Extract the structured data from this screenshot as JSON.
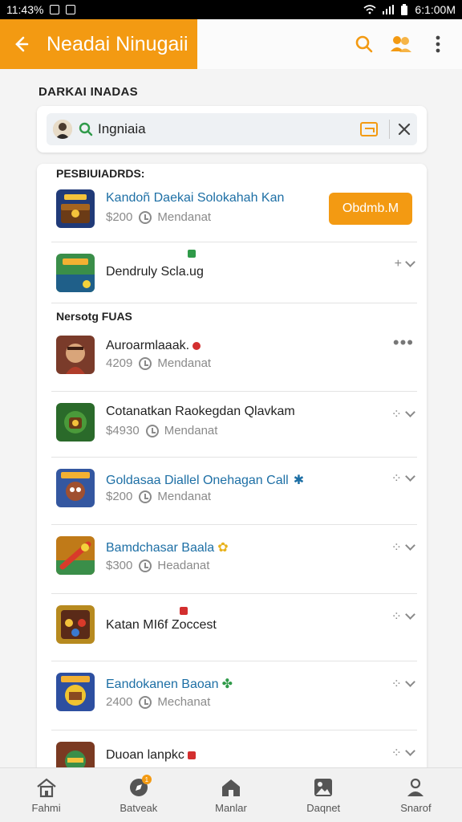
{
  "status_bar": {
    "time": "11:43%",
    "right_time": "6:1:00M"
  },
  "app_bar": {
    "title": "Neadai Ninugaii"
  },
  "section_label": "DARKAI INADAS",
  "search": {
    "value": "Ingniaia"
  },
  "list": {
    "header_1": "PESBIUIADRDS:",
    "header_2": "Nersotg FUAS",
    "featured": {
      "name": "Kandoñ Daekai Solokahah Kan",
      "price": "$200",
      "status": "Mendanat",
      "button": "Obdmb.M"
    },
    "items": [
      {
        "name": "Dendruly Scla.ug",
        "price": "",
        "status": "",
        "theme": "#2f8b3e"
      },
      {
        "name": "Auroarmlaaak.",
        "price": "4209",
        "status": "Mendanat",
        "theme": "#7a3b2a"
      },
      {
        "name": "Cotanatkan Raokegdan Qlavkam",
        "price": "$4930",
        "status": "Mendanat",
        "theme": "#2a6a2a"
      },
      {
        "name": "Goldasaa Diallel Onehagan Call",
        "price": "$200",
        "status": "Mendanat",
        "theme": "#3457a0"
      },
      {
        "name": "Bamdchasar Baala",
        "price": "$300",
        "status": "Headanat",
        "theme": "#c07a18"
      },
      {
        "name": "Katan MI6f Zoccest",
        "price": "",
        "status": "",
        "theme": "#b78a1f"
      },
      {
        "name": "Eandokanen Baoan",
        "price": "2400",
        "status": "Mechanat",
        "theme": "#2d4fa0"
      },
      {
        "name": "Duoan lanpkc",
        "price": "",
        "status": "",
        "theme": "#7a3a22"
      }
    ]
  },
  "bottom_nav": [
    {
      "label": "Fahmi",
      "icon": "home-icon"
    },
    {
      "label": "Batveak",
      "icon": "compass-icon",
      "badge": "1"
    },
    {
      "label": "Manlar",
      "icon": "house-filled-icon"
    },
    {
      "label": "Daqnet",
      "icon": "gallery-icon"
    },
    {
      "label": "Snarof",
      "icon": "profile-icon"
    }
  ],
  "colors": {
    "accent": "#f39a12",
    "link": "#1d6fa5"
  }
}
